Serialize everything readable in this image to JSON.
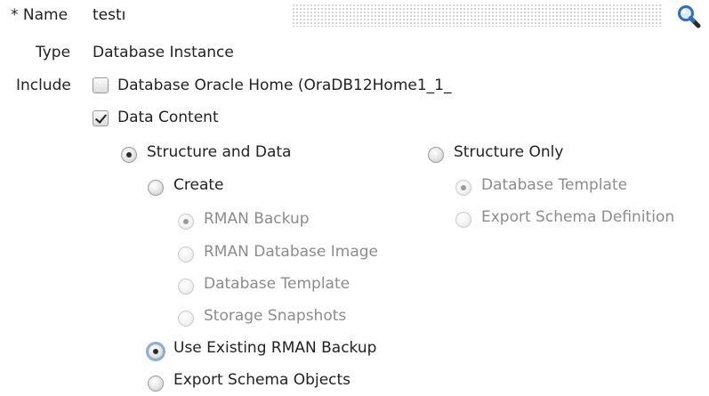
{
  "name_row": {
    "required_marker": "* Name",
    "value": "testı",
    "search_icon": "magnifier-icon"
  },
  "type_row": {
    "label": "Type",
    "value": "Database Instance"
  },
  "include": {
    "label": "Include",
    "oracle_home": "Database Oracle Home (OraDB12Home1_1_",
    "data_content": "Data Content"
  },
  "content_options": {
    "structure_and_data": "Structure and Data",
    "structure_only": "Structure Only",
    "create": "Create",
    "rman_backup": "RMAN Backup",
    "rman_database_image": "RMAN Database Image",
    "database_template": "Database Template",
    "storage_snapshots": "Storage Snapshots",
    "use_existing_rman_backup": "Use Existing RMAN Backup",
    "export_schema_objects": "Export Schema Objects",
    "so_database_template": "Database Template",
    "so_export_schema_definition": "Export Schema Definition"
  },
  "colors": {
    "magnifier_blue": "#2f6fc0",
    "disabled_text": "#8c8c8c",
    "focus_ring": "#7fb3e6"
  }
}
